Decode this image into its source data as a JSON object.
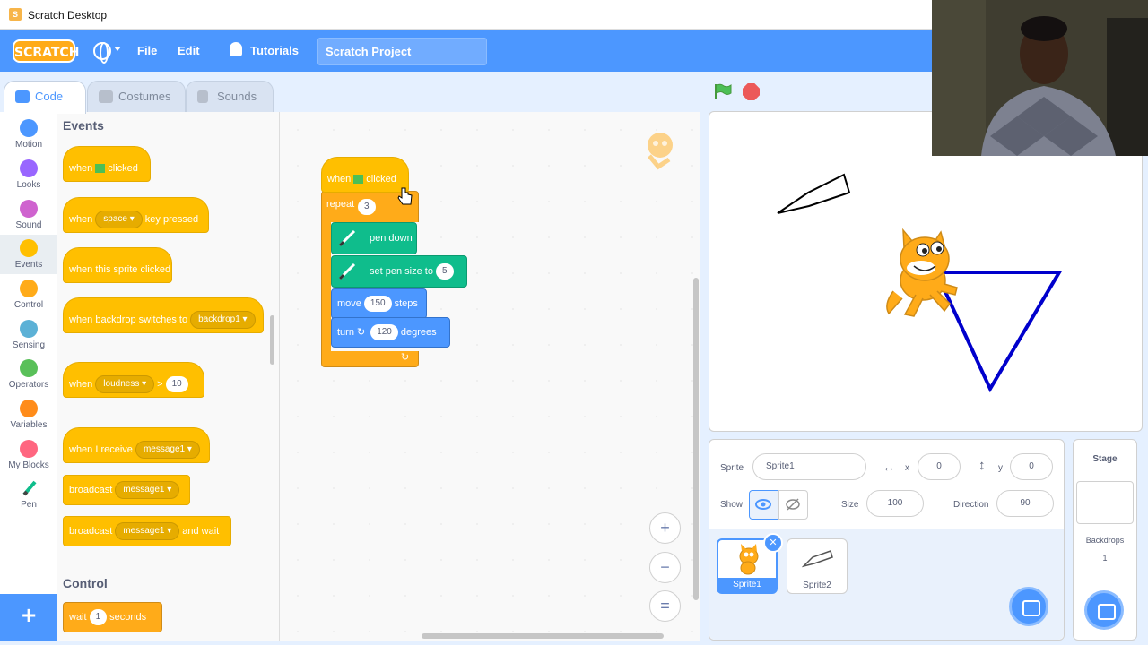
{
  "window": {
    "title": "Scratch Desktop"
  },
  "menubar": {
    "logo": "SCRATCH",
    "file": "File",
    "edit": "Edit",
    "tutorials": "Tutorials",
    "project_title": "Scratch Project"
  },
  "tabs": [
    {
      "label": "Code"
    },
    {
      "label": "Costumes"
    },
    {
      "label": "Sounds"
    }
  ],
  "categories": [
    {
      "label": "Motion",
      "color": "#4c97ff"
    },
    {
      "label": "Looks",
      "color": "#9966ff"
    },
    {
      "label": "Sound",
      "color": "#cf63cf"
    },
    {
      "label": "Events",
      "color": "#ffbf00"
    },
    {
      "label": "Control",
      "color": "#ffab19"
    },
    {
      "label": "Sensing",
      "color": "#5cb1d6"
    },
    {
      "label": "Operators",
      "color": "#59c059"
    },
    {
      "label": "Variables",
      "color": "#ff8c1a"
    },
    {
      "label": "My Blocks",
      "color": "#ff6680"
    },
    {
      "label": "Pen",
      "color": "#0fbd8c"
    }
  ],
  "palette": {
    "events_heading": "Events",
    "control_heading": "Control",
    "when_flag": {
      "a": "when",
      "b": "clicked"
    },
    "when_key": {
      "a": "when",
      "key": "space",
      "b": "key pressed"
    },
    "when_sprite_clicked": "when this sprite clicked",
    "when_backdrop": {
      "a": "when backdrop switches to",
      "backdrop": "backdrop1"
    },
    "when_loudness": {
      "a": "when",
      "sensor": "loudness",
      "op": ">",
      "value": "10"
    },
    "when_receive": {
      "a": "when I receive",
      "msg": "message1"
    },
    "broadcast": {
      "a": "broadcast",
      "msg": "message1"
    },
    "broadcast_wait": {
      "a": "broadcast",
      "msg": "message1",
      "b": "and wait"
    },
    "wait": {
      "a": "wait",
      "value": "1",
      "b": "seconds"
    }
  },
  "script": {
    "hat": {
      "a": "when",
      "b": "clicked"
    },
    "repeat": {
      "a": "repeat",
      "value": "3"
    },
    "pen_down": "pen down",
    "set_pen_size": {
      "a": "set pen size to",
      "value": "5"
    },
    "move": {
      "a": "move",
      "value": "150",
      "b": "steps"
    },
    "turn": {
      "a": "turn",
      "value": "120",
      "b": "degrees"
    }
  },
  "zoom": {
    "in": "+",
    "out": "−",
    "reset": "="
  },
  "sprite_info": {
    "sprite_label": "Sprite",
    "sprite_name": "Sprite1",
    "x_label": "x",
    "x_value": "0",
    "y_label": "y",
    "y_value": "0",
    "show_label": "Show",
    "size_label": "Size",
    "size_value": "100",
    "direction_label": "Direction",
    "direction_value": "90"
  },
  "sprites": [
    {
      "name": "Sprite1"
    },
    {
      "name": "Sprite2"
    }
  ],
  "stage_pane": {
    "title": "Stage",
    "backdrops_label": "Backdrops",
    "backdrops_count": "1"
  }
}
